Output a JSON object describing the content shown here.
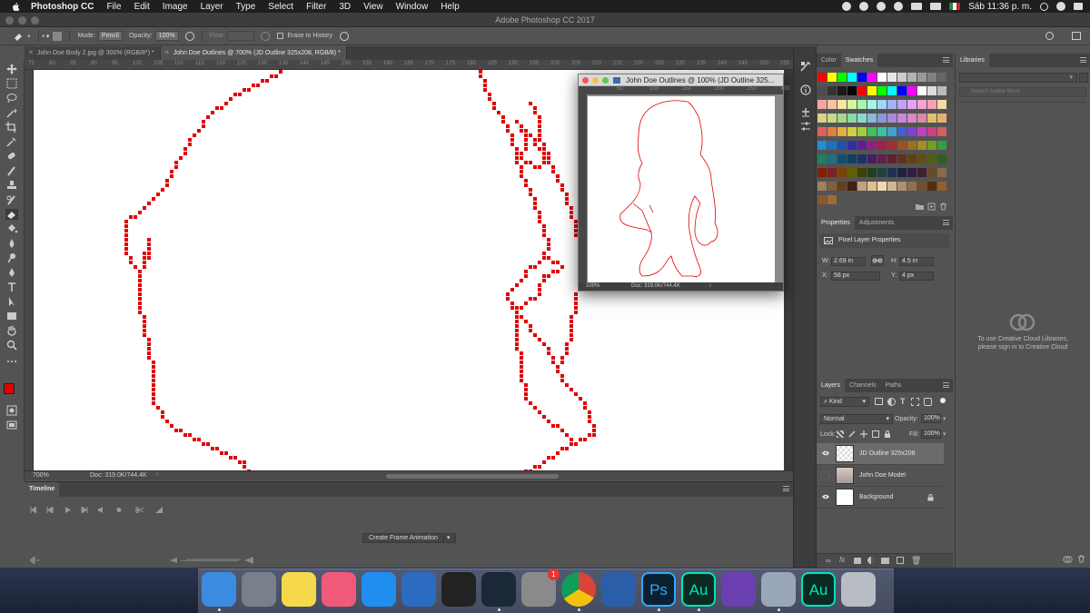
{
  "menubar": {
    "app": "Photoshop CC",
    "items": [
      "File",
      "Edit",
      "Image",
      "Layer",
      "Type",
      "Select",
      "Filter",
      "3D",
      "View",
      "Window",
      "Help"
    ],
    "clock": "Sáb 11:36 p. m."
  },
  "window": {
    "title": "Adobe Photoshop CC 2017"
  },
  "options": {
    "mode_label": "Mode:",
    "mode_value": "Pencil",
    "opacity_label": "Opacity:",
    "opacity_value": "100%",
    "flow_label": "Flow:",
    "erase_history": "Erase to History"
  },
  "doc_tabs": [
    {
      "label": "John Doe Body 2.jpg @ 300% (RGB/8*) *"
    },
    {
      "label": "John Doe Outlines @ 700% (JD Outline 325x208, RGB/8) *"
    }
  ],
  "ruler_top": [
    "75",
    "80",
    "85",
    "90",
    "95",
    "100",
    "105",
    "110",
    "115",
    "120",
    "125",
    "130",
    "135",
    "140",
    "145",
    "150",
    "155",
    "160",
    "165",
    "170",
    "175",
    "180",
    "185",
    "190",
    "195",
    "200",
    "205",
    "210",
    "215",
    "220",
    "225",
    "230",
    "235",
    "240",
    "245",
    "250",
    "255"
  ],
  "status": {
    "zoom": "700%",
    "doc": "Doc: 319.0K/744.4K"
  },
  "timeline": {
    "tab": "Timeline",
    "create_button": "Create Frame Animation"
  },
  "float_window": {
    "title": "John Doe Outlines @ 100% (JD Outline 325...",
    "ruler": [
      "50",
      "100",
      "150",
      "200",
      "250",
      "300"
    ],
    "zoom": "100%",
    "doc": "Doc: 319.0K/744.4K"
  },
  "swatches_panel": {
    "tabs": [
      "Color",
      "Swatches"
    ]
  },
  "libraries_panel": {
    "tab": "Libraries",
    "search_placeholder": "Search Adobe Stock",
    "message": "To use Creative Cloud Libraries, please sign in to Creative Cloud"
  },
  "properties_panel": {
    "tabs": [
      "Properties",
      "Adjustments"
    ],
    "heading": "Pixel Layer Properties",
    "w_label": "W:",
    "w_value": "2.69 in",
    "h_label": "H:",
    "h_value": "4.5 in",
    "x_label": "X:",
    "x_value": "58 px",
    "y_label": "Y:",
    "y_value": "4 px"
  },
  "layers_panel": {
    "tabs": [
      "Layers",
      "Channels",
      "Paths"
    ],
    "kind": "Kind",
    "blend_mode": "Normal",
    "opacity_label": "Opacity:",
    "opacity_value": "100%",
    "lock_label": "Lock:",
    "fill_label": "Fill:",
    "fill_value": "100%",
    "layers": [
      {
        "name": "JD Outline 325x208",
        "visible": true,
        "active": true
      },
      {
        "name": "John Doe Model",
        "visible": false,
        "active": false
      },
      {
        "name": "Background",
        "visible": true,
        "active": false,
        "locked": true
      }
    ]
  },
  "colors": {
    "foreground": "#e00000",
    "background": "#ffffff",
    "outline": "#e00000"
  },
  "dock": [
    {
      "name": "Finder",
      "color": "#3b8ce0"
    },
    {
      "name": "Launchpad",
      "color": "#7a7f8c"
    },
    {
      "name": "Notes",
      "color": "#f6d94a"
    },
    {
      "name": "Music",
      "color": "#f05a7a"
    },
    {
      "name": "App Store",
      "color": "#1f8ef0"
    },
    {
      "name": "Xcode",
      "color": "#2b6cc0"
    },
    {
      "name": "Unity",
      "color": "#222222"
    },
    {
      "name": "Steam",
      "color": "#1b2838"
    },
    {
      "name": "System Preferences",
      "color": "#8a8a8a",
      "badge": "1"
    },
    {
      "name": "Chrome",
      "color": "#e8e8e8"
    },
    {
      "name": "Word",
      "color": "#2b5ea8"
    },
    {
      "name": "Photoshop",
      "color": "#0b2030",
      "label": "Ps"
    },
    {
      "name": "Audition",
      "color": "#0a2a22",
      "label": "Au"
    },
    {
      "name": "Visual Studio",
      "color": "#6b3fb0"
    },
    {
      "name": "Preview",
      "color": "#9aa7b8"
    },
    {
      "name": "Audition Doc",
      "color": "#0a2a22",
      "label": "Au"
    },
    {
      "name": "Trash",
      "color": "#b8bcc4"
    }
  ]
}
